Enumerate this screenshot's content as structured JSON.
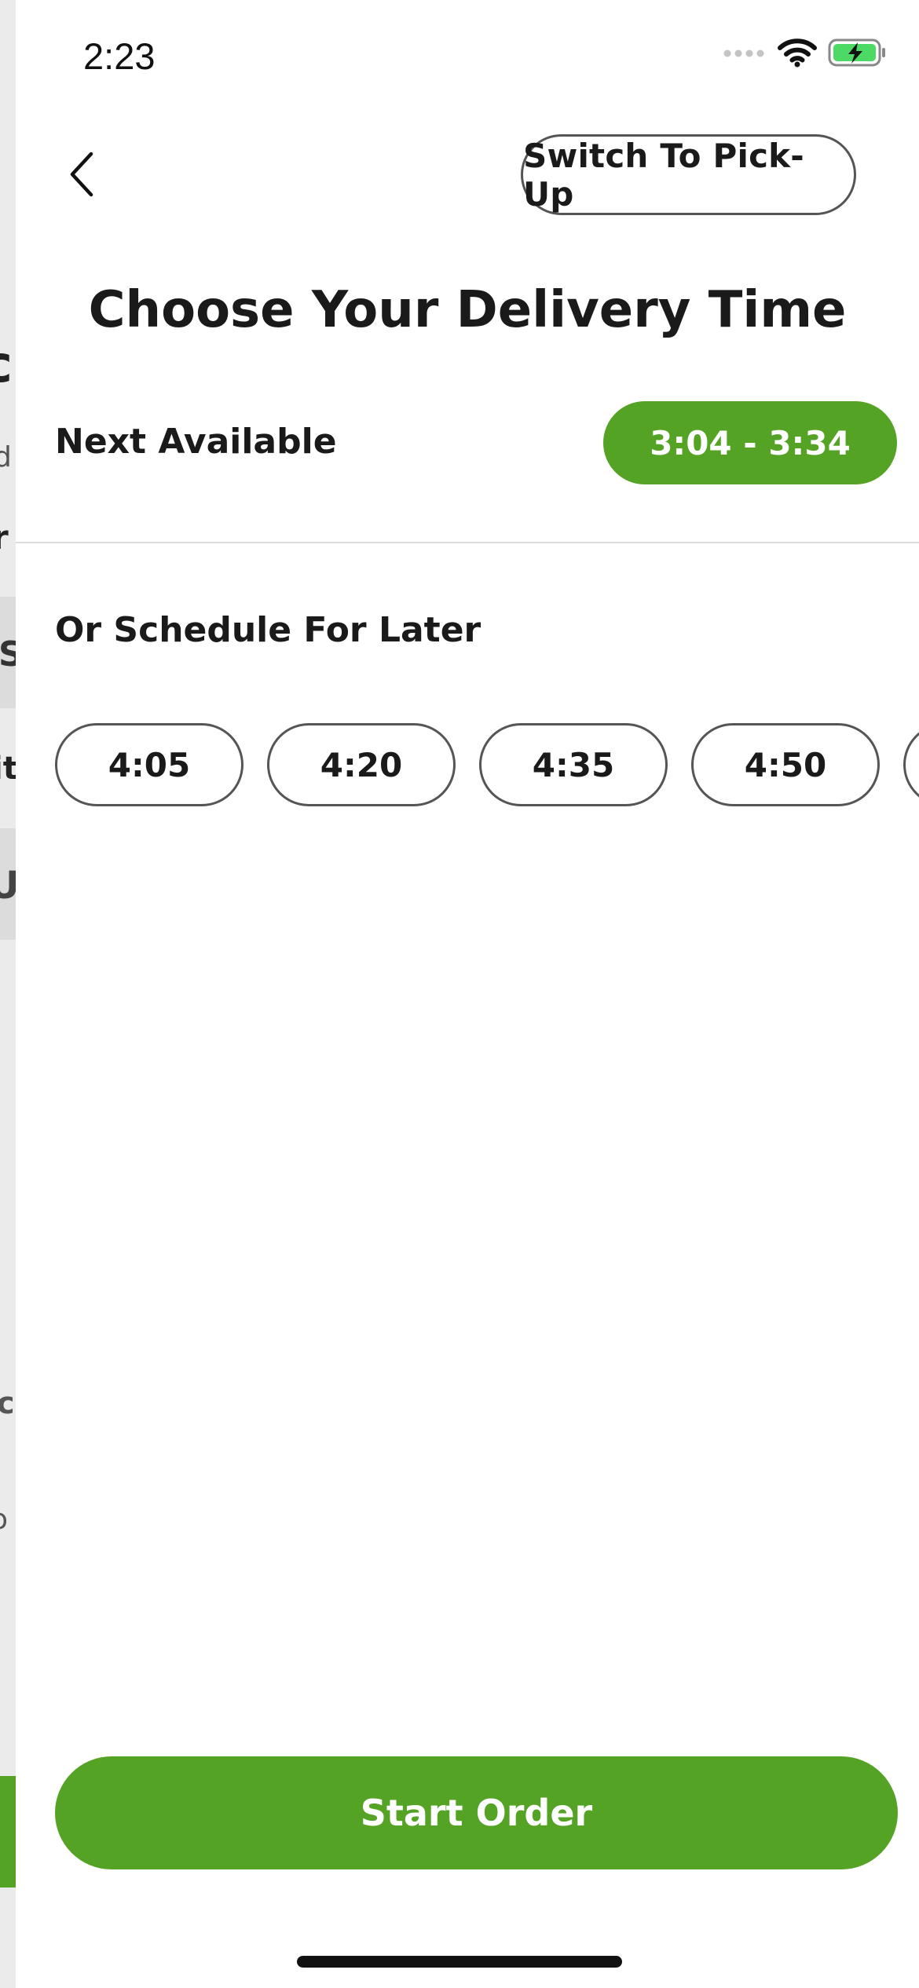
{
  "status_bar": {
    "time": "2:23",
    "icons": [
      "signal-dots-icon",
      "wifi-icon",
      "battery-charging-icon"
    ],
    "battery_color": "#4cd964"
  },
  "background_peek": {
    "fragments": [
      "cl",
      "d",
      "r",
      "S",
      "it",
      "U",
      "c",
      "o"
    ]
  },
  "header": {
    "back_icon": "chevron-left-icon",
    "switch_label": "Switch To Pick-Up"
  },
  "title": "Choose Your Delivery Time",
  "next_available": {
    "label": "Next Available",
    "slot": "3:04 - 3:34"
  },
  "schedule": {
    "label": "Or Schedule For Later",
    "slots": [
      "4:05",
      "4:20",
      "4:35",
      "4:50",
      ""
    ]
  },
  "footer": {
    "start_label": "Start Order"
  },
  "colors": {
    "accent": "#55a325",
    "text": "#1a1a1a",
    "border": "#555555",
    "divider": "#dcdcdc"
  }
}
